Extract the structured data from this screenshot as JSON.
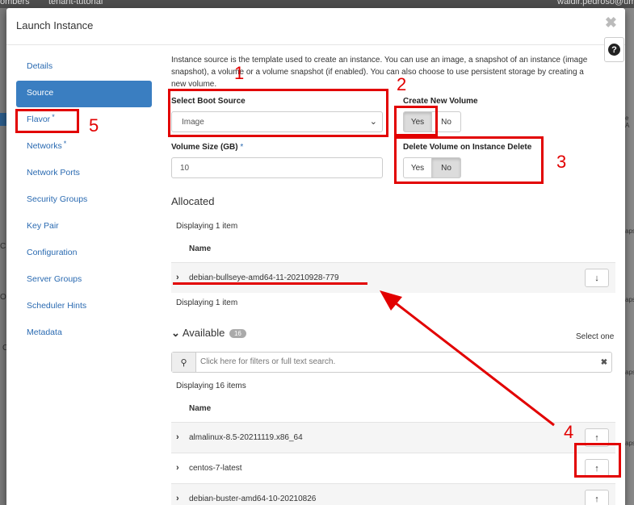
{
  "background": {
    "top_left_text": "ombers",
    "top_project": "tenant-tutorial",
    "top_user": "waldir.pedroso@um",
    "side_letters": [
      "C",
      "O",
      "C"
    ],
    "right_fragments": [
      "e A",
      "aps",
      "aps",
      "aps",
      "aps"
    ]
  },
  "modal": {
    "title": "Launch Instance",
    "close_symbol": "✖",
    "help_symbol": "?"
  },
  "nav": {
    "items": [
      {
        "label": "Details",
        "required": false
      },
      {
        "label": "Source",
        "required": false
      },
      {
        "label": "Flavor",
        "required": true
      },
      {
        "label": "Networks",
        "required": true
      },
      {
        "label": "Network Ports",
        "required": false
      },
      {
        "label": "Security Groups",
        "required": false
      },
      {
        "label": "Key Pair",
        "required": false
      },
      {
        "label": "Configuration",
        "required": false
      },
      {
        "label": "Server Groups",
        "required": false
      },
      {
        "label": "Scheduler Hints",
        "required": false
      },
      {
        "label": "Metadata",
        "required": false
      }
    ],
    "active": "Source",
    "required_marker": "*"
  },
  "source": {
    "intro_line1": "Instance source is the template used to create an instance. You can use an image, a snapshot of an instance (image",
    "intro_line2": "snapshot), a volume or a volume snapshot (if enabled). You can also choose to use persistent storage by creating a",
    "intro_line3": "new volume.",
    "boot_source_label": "Select Boot Source",
    "boot_source_value": "Image",
    "create_volume_label": "Create New Volume",
    "create_volume_yes": "Yes",
    "create_volume_no": "No",
    "create_volume_selected": "Yes",
    "volume_size_label": "Volume Size (GB)",
    "volume_size_value": "10",
    "delete_volume_label": "Delete Volume on Instance Delete",
    "delete_volume_yes": "Yes",
    "delete_volume_no": "No",
    "delete_volume_selected": "No"
  },
  "allocated": {
    "title": "Allocated",
    "count_text_top": "Displaying 1 item",
    "column_name": "Name",
    "rows": [
      "debian-bullseye-amd64-11-20210928-779"
    ],
    "count_text_bottom": "Displaying 1 item"
  },
  "available": {
    "title": "Available",
    "count_badge": "16",
    "select_hint": "Select one",
    "search_placeholder": "Click here for filters or full text search.",
    "count_text": "Displaying 16 items",
    "column_name": "Name",
    "rows": [
      "almalinux-8.5-20211119.x86_64",
      "centos-7-latest",
      "debian-buster-amd64-10-20210826"
    ]
  },
  "annotations": {
    "numbers": [
      "1",
      "2",
      "3",
      "4",
      "5"
    ],
    "color": "#e20000"
  },
  "colors": {
    "accent": "#3a7ec1",
    "link": "#2a6ab1"
  }
}
